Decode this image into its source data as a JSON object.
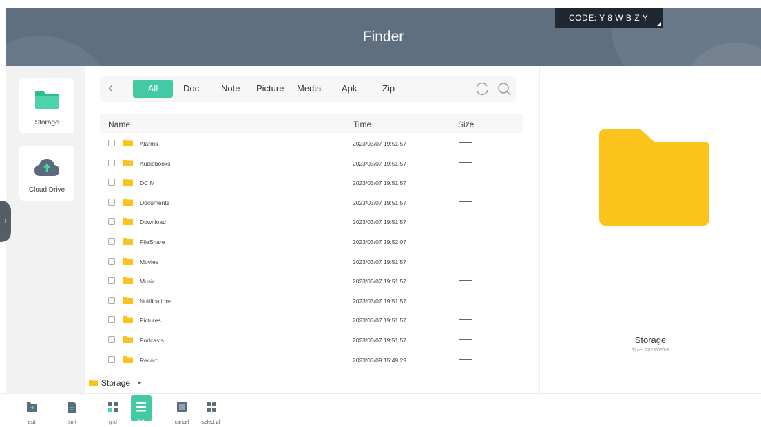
{
  "header": {
    "title": "Finder",
    "code": "CODE: Y 8 W B Z Y",
    "bg_color": "#5f6f80"
  },
  "sidebar": {
    "items": [
      {
        "label": "Storage",
        "icon": "folder-icon"
      },
      {
        "label": "Cloud Drive",
        "icon": "cloud-upload-icon"
      }
    ],
    "edge_tab_glyph": "›"
  },
  "toolbar": {
    "back_glyph": "‹",
    "filters": [
      "All",
      "Doc",
      "Note",
      "Picture",
      "Media",
      "Apk",
      "Zip"
    ],
    "active_filter": "All",
    "icons": [
      "refresh-icon",
      "search-icon"
    ]
  },
  "table": {
    "headers": {
      "name": "Name",
      "time": "Time",
      "size": "Size"
    },
    "rows": [
      {
        "name": "Alarms",
        "time": "2023/03/07 19:51:57"
      },
      {
        "name": "Audiobooks",
        "time": "2023/03/07 19:51:57"
      },
      {
        "name": "DCIM",
        "time": "2023/03/07 19:51:57"
      },
      {
        "name": "Documents",
        "time": "2023/03/07 19:51:57"
      },
      {
        "name": "Download",
        "time": "2023/03/07 19:51:57"
      },
      {
        "name": "FileShare",
        "time": "2023/03/07 19:52:07"
      },
      {
        "name": "Movies",
        "time": "2023/03/07 19:51:57"
      },
      {
        "name": "Music",
        "time": "2023/03/07 19:51:57"
      },
      {
        "name": "Notifications",
        "time": "2023/03/07 19:51:57"
      },
      {
        "name": "Pictures",
        "time": "2023/03/07 19:51:57"
      },
      {
        "name": "Podcasts",
        "time": "2023/03/07 19:51:57"
      },
      {
        "name": "Record",
        "time": "2023/03/09 15:49:29"
      }
    ]
  },
  "breadcrumb": {
    "label": "Storage",
    "arrow": "▸"
  },
  "detail": {
    "name": "Storage",
    "time": "Time: 2023/03/09"
  },
  "bottom_bar": {
    "buttons": [
      {
        "label": "exit",
        "icon": "exit-icon"
      },
      {
        "label": "sort",
        "icon": "sort-icon"
      },
      {
        "label": "grid",
        "icon": "grid-icon"
      },
      {
        "label": "list",
        "icon": "list-icon",
        "active": true
      },
      {
        "label": "cancel",
        "icon": "cancel-icon"
      },
      {
        "label": "select all",
        "icon": "select-all-icon"
      }
    ]
  },
  "colors": {
    "accent": "#43c9a3",
    "folder": "#fbc31c",
    "header": "#5f6f80"
  }
}
